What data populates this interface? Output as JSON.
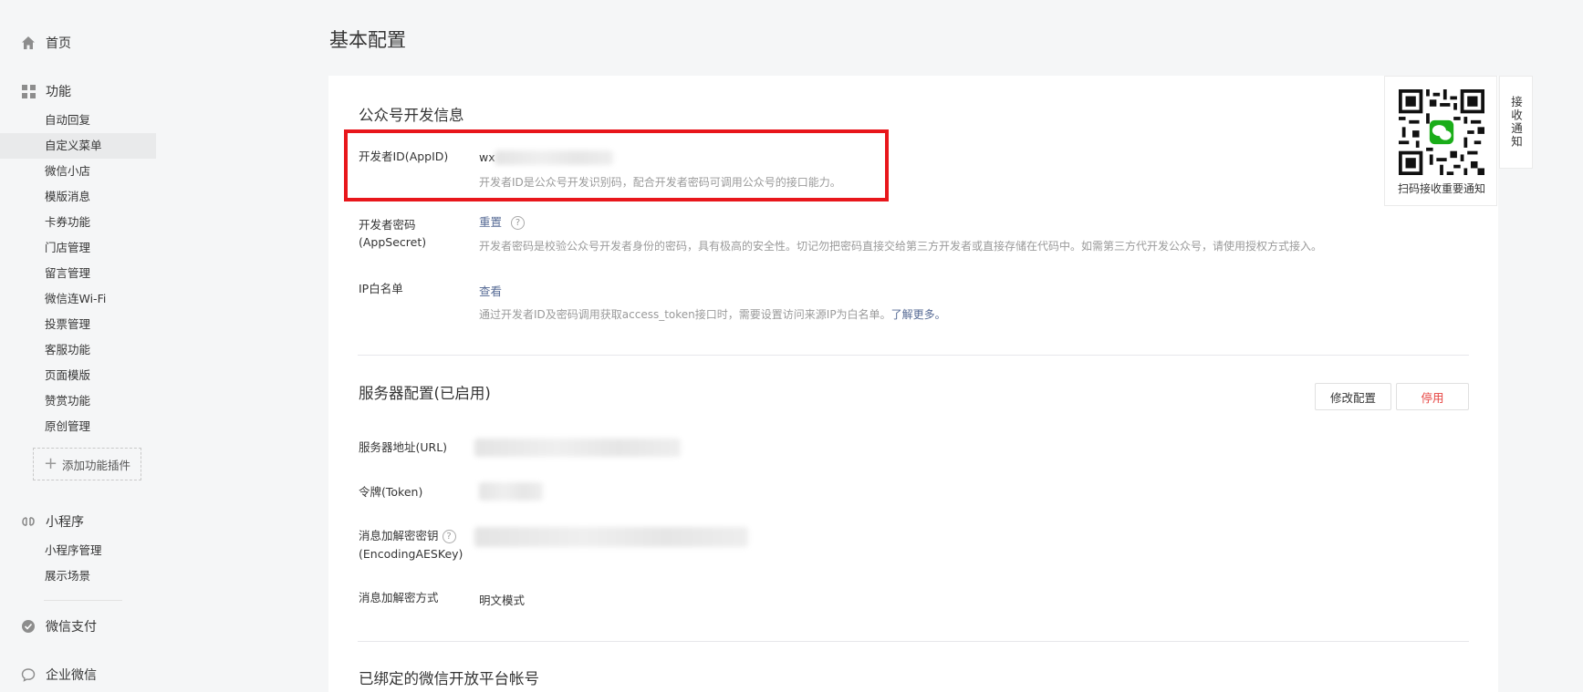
{
  "sidebar": {
    "home": "首页",
    "features": {
      "label": "功能",
      "items": [
        "自动回复",
        "自定义菜单",
        "微信小店",
        "模版消息",
        "卡券功能",
        "门店管理",
        "留言管理",
        "微信连Wi-Fi",
        "投票管理",
        "客服功能",
        "页面模版",
        "赞赏功能",
        "原创管理"
      ],
      "active_index": 1,
      "add_plugin": "添加功能插件"
    },
    "miniprogram": {
      "label": "小程序",
      "items": [
        "小程序管理",
        "展示场景"
      ]
    },
    "wechat_pay": "微信支付",
    "work_wechat": "企业微信"
  },
  "page_title": "基本配置",
  "dev_info": {
    "title": "公众号开发信息",
    "appid_label": "开发者ID(AppID)",
    "appid_prefix": "wx",
    "appid_desc": "开发者ID是公众号开发识别码，配合开发者密码可调用公众号的接口能力。",
    "secret_label_1": "开发者密码",
    "secret_label_2": "(AppSecret)",
    "secret_action": "重置",
    "secret_desc": "开发者密码是校验公众号开发者身份的密码，具有极高的安全性。切记勿把密码直接交给第三方开发者或直接存储在代码中。如需第三方代开发公众号，请使用授权方式接入。",
    "ip_label": "IP白名单",
    "ip_action": "查看",
    "ip_desc": "通过开发者ID及密码调用获取access_token接口时，需要设置访问来源IP为白名单。",
    "ip_learn_more": "了解更多。"
  },
  "server": {
    "title": "服务器配置(已启用)",
    "edit_button": "修改配置",
    "disable_button": "停用",
    "url_label": "服务器地址(URL)",
    "token_label": "令牌(Token)",
    "aes_label_1": "消息加解密密钥",
    "aes_label_2": "(EncodingAESKey)",
    "mode_label": "消息加解密方式",
    "mode_value": "明文模式"
  },
  "bound_title": "已绑定的微信开放平台帐号",
  "qr": {
    "caption": "扫码接收重要通知"
  },
  "side_tab": "接收通知",
  "colors": {
    "highlight": "#e8161b",
    "link": "#576b95",
    "danger": "#e64340",
    "wechat_green": "#1aad19"
  }
}
